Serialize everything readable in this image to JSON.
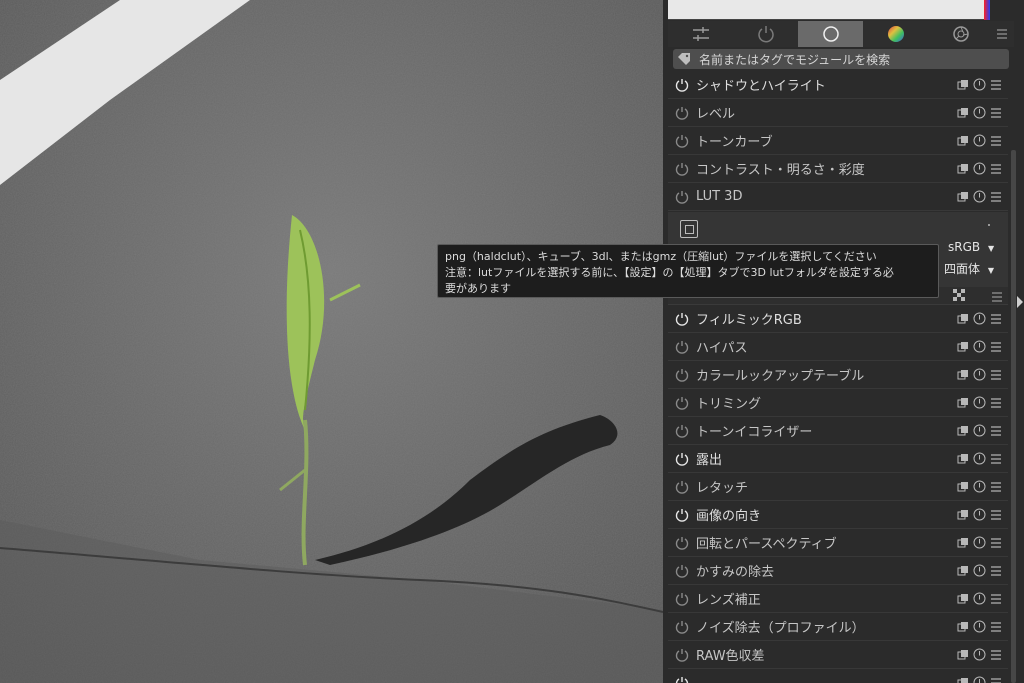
{
  "search": {
    "placeholder": "名前またはタグでモジュールを検索"
  },
  "tabs": [
    {
      "icon": "sliders-icon"
    },
    {
      "icon": "power-icon"
    },
    {
      "icon": "circle-icon",
      "active": true
    },
    {
      "icon": "color-wheel-icon"
    },
    {
      "icon": "aperture-icon"
    }
  ],
  "modules_top": [
    {
      "name": "シャドウとハイライト",
      "on": true
    },
    {
      "name": "レベル",
      "on": false
    },
    {
      "name": "トーンカーブ",
      "on": false
    },
    {
      "name": "コントラスト・明るさ・彩度",
      "on": false
    },
    {
      "name": "LUT 3D",
      "on": false
    }
  ],
  "lut3d": {
    "colorspace_value": "sRGB",
    "interpolation_value": "四面体"
  },
  "tooltip": {
    "line1": "png（haldclut）、キューブ、3dl、またはgmz（圧縮lut）ファイルを選択してください",
    "line2": "注意：lutファイルを選択する前に、【設定】の【処理】タブで3D lutフォルダを設定する必",
    "line3": "要があります"
  },
  "modules_bottom": [
    {
      "name": "フィルミックRGB",
      "on": true
    },
    {
      "name": "ハイパス",
      "on": false
    },
    {
      "name": "カラールックアップテーブル",
      "on": false
    },
    {
      "name": "トリミング",
      "on": false
    },
    {
      "name": "トーンイコライザー",
      "on": false
    },
    {
      "name": "露出",
      "on": true
    },
    {
      "name": "レタッチ",
      "on": false
    },
    {
      "name": "画像の向き",
      "on": true
    },
    {
      "name": "回転とパースペクティブ",
      "on": false
    },
    {
      "name": "かすみの除去",
      "on": false
    },
    {
      "name": "レンズ補正",
      "on": false
    },
    {
      "name": "ノイズ除去（プロファイル）",
      "on": false
    },
    {
      "name": "RAW色収差",
      "on": false
    },
    {
      "name": "",
      "on": true
    }
  ],
  "colors": {
    "panel": "#2b2b2b",
    "active_tab": "#6a6a6a",
    "tooltip_bg": "#1d1d1d"
  }
}
